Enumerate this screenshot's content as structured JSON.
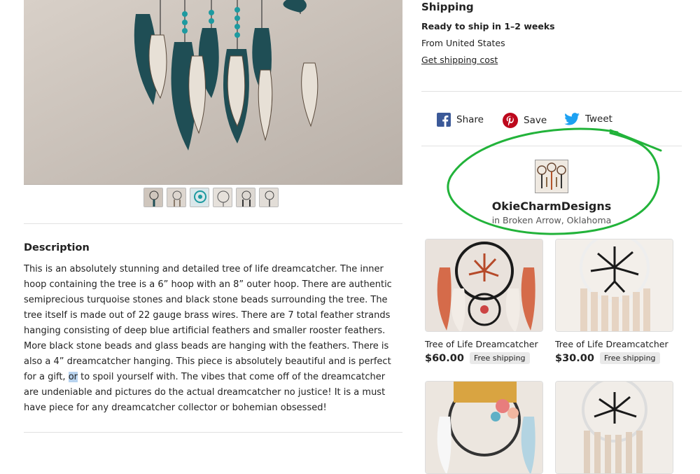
{
  "shipping": {
    "title": "Shipping",
    "ready": "Ready to ship in 1–2 weeks",
    "from": "From United States",
    "link": "Get shipping cost"
  },
  "social": [
    {
      "label": "Share",
      "icon": "facebook-icon",
      "color": "#3b5998"
    },
    {
      "label": "Save",
      "icon": "pinterest-icon",
      "color": "#bd081c"
    },
    {
      "label": "Tweet",
      "icon": "twitter-icon",
      "color": "#1da1f2"
    }
  ],
  "shop": {
    "name": "OkieCharmDesigns",
    "location": "in Broken Arrow, Oklahoma"
  },
  "annotation_color": "#22b33a",
  "description": {
    "heading": "Description",
    "before_highlight": "This is an absolutely stunning and detailed tree of life dreamcatcher. The inner hoop containing the tree is a 6” hoop with an 8” outer hoop. There are authentic semiprecious turquoise stones and black stone beads surrounding the tree. The tree itself is made out of 22 gauge brass wires. There are 7 total feather strands hanging consisting of deep blue artificial feathers and smaller rooster feathers. More black stone beads and glass beads are hanging with the feathers. There is also a 4” dreamcatcher hanging. This piece is absolutely beautiful and is perfect for a gift, ",
    "highlight": "or",
    "after_highlight": " to spoil yourself with. The vibes that come off of the dreamcatcher are undeniable and pictures do the actual dreamcatcher no justice! It is a must have piece for any dreamcatcher collector or bohemian obsessed!"
  },
  "listings": [
    {
      "title": "Tree of Life Dreamcatcher",
      "price": "$60.00",
      "badge": "Free shipping"
    },
    {
      "title": "Tree of Life Dreamcatcher",
      "price": "$30.00",
      "badge": "Free shipping"
    },
    {
      "title": "",
      "price": "",
      "badge": ""
    },
    {
      "title": "",
      "price": "",
      "badge": ""
    }
  ]
}
